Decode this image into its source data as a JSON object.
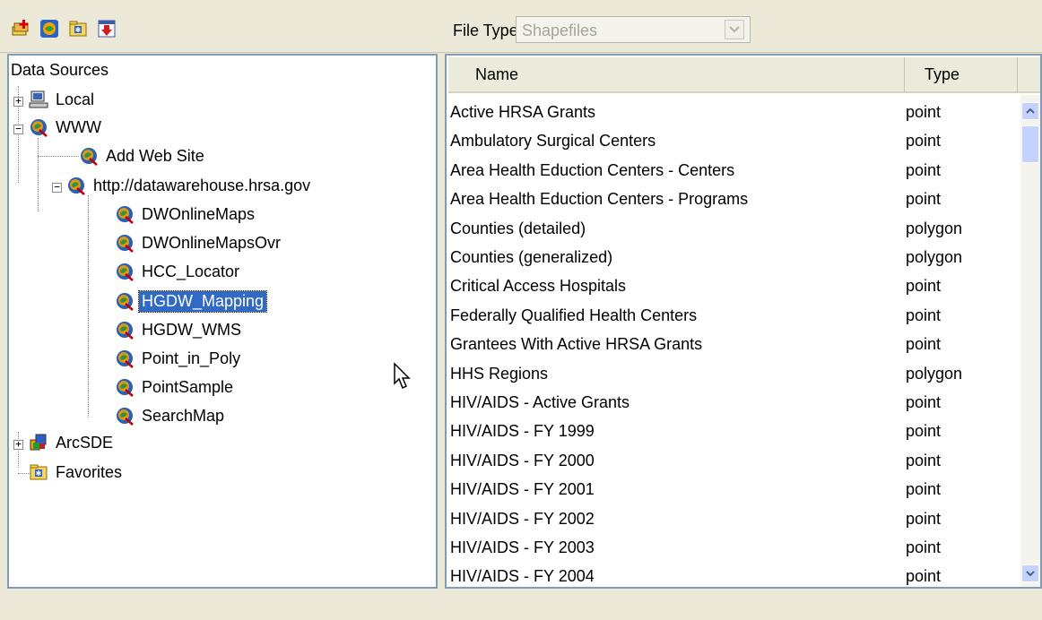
{
  "toolbar": {
    "buttons": [
      {
        "name": "add-data-button",
        "icon": "add-layer-icon"
      },
      {
        "name": "internet-button",
        "icon": "globe-icon"
      },
      {
        "name": "add-favorite-button",
        "icon": "favorite-folder-icon"
      },
      {
        "name": "export-button",
        "icon": "download-arrow-icon"
      }
    ],
    "file_type_label": "File Type:",
    "file_type_value": "Shapefiles"
  },
  "tree": {
    "root_label": "Data Sources",
    "nodes": [
      {
        "label": "Local",
        "icon": "computer-icon"
      },
      {
        "label": "WWW",
        "icon": "globe-icon"
      },
      {
        "label": "Add Web Site",
        "icon": "globe-icon"
      },
      {
        "label": "http://datawarehouse.hrsa.gov",
        "icon": "globe-icon"
      },
      {
        "label": "DWOnlineMaps",
        "icon": "globe-icon"
      },
      {
        "label": "DWOnlineMapsOvr",
        "icon": "globe-icon"
      },
      {
        "label": "HCC_Locator",
        "icon": "globe-icon"
      },
      {
        "label": "HGDW_Mapping",
        "icon": "globe-icon",
        "selected": true
      },
      {
        "label": "HGDW_WMS",
        "icon": "globe-icon"
      },
      {
        "label": "Point_in_Poly",
        "icon": "globe-icon"
      },
      {
        "label": "PointSample",
        "icon": "globe-icon"
      },
      {
        "label": "SearchMap",
        "icon": "globe-icon"
      },
      {
        "label": "ArcSDE",
        "icon": "database-icon"
      },
      {
        "label": "Favorites",
        "icon": "favorite-folder-icon"
      }
    ]
  },
  "table": {
    "columns": [
      "Name",
      "Type"
    ],
    "rows": [
      [
        "Active HRSA Grants",
        "point"
      ],
      [
        "Ambulatory Surgical Centers",
        "point"
      ],
      [
        "Area Health Eduction Centers - Centers",
        "point"
      ],
      [
        "Area Health Eduction Centers - Programs",
        "point"
      ],
      [
        "Counties (detailed)",
        "polygon"
      ],
      [
        "Counties (generalized)",
        "polygon"
      ],
      [
        "Critical Access Hospitals",
        "point"
      ],
      [
        "Federally Qualified Health Centers",
        "point"
      ],
      [
        "Grantees With Active HRSA Grants",
        "point"
      ],
      [
        "HHS Regions",
        "polygon"
      ],
      [
        "HIV/AIDS - Active Grants",
        "point"
      ],
      [
        "HIV/AIDS - FY 1999",
        "point"
      ],
      [
        "HIV/AIDS - FY 2000",
        "point"
      ],
      [
        "HIV/AIDS - FY 2001",
        "point"
      ],
      [
        "HIV/AIDS - FY 2002",
        "point"
      ],
      [
        "HIV/AIDS - FY 2003",
        "point"
      ],
      [
        "HIV/AIDS - FY 2004",
        "point"
      ]
    ]
  },
  "colors": {
    "selection": "#316ac5",
    "window_bg": "#ece9d8",
    "pane_border": "#7f9db9",
    "scrollbar": "#c3d3fd"
  }
}
